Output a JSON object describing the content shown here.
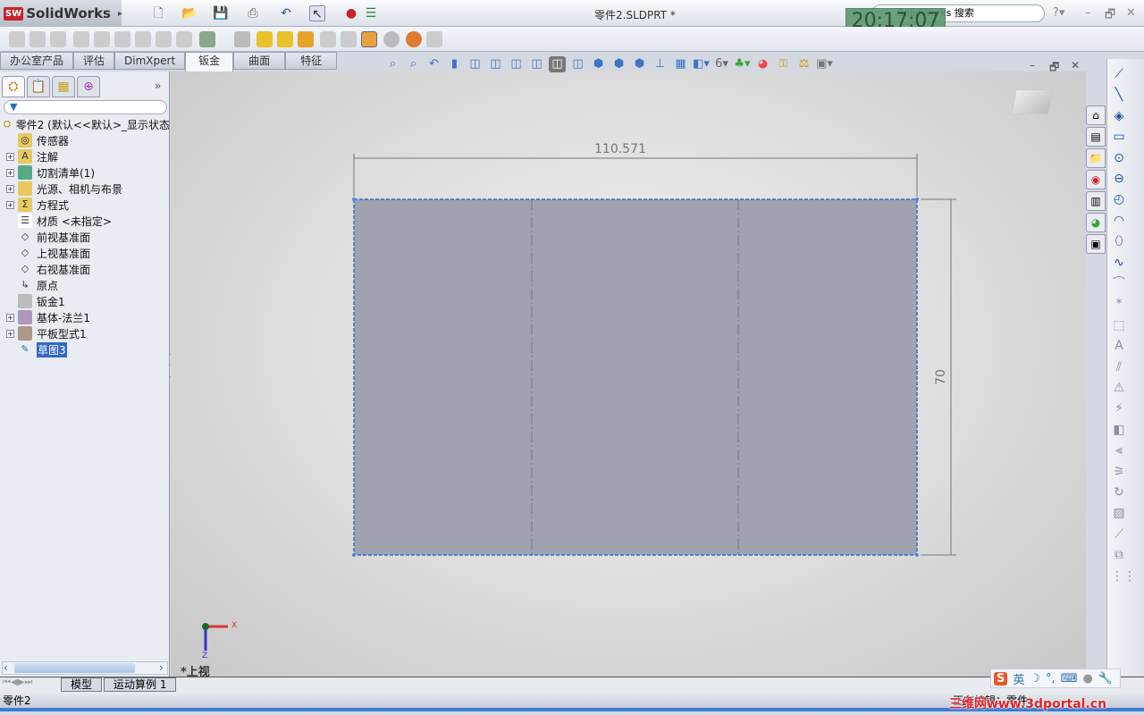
{
  "app": {
    "name": "SolidWorks",
    "document_title": "零件2.SLDPRT *",
    "clock": "20:17:07",
    "search_placeholder": "SolidWorks 搜索"
  },
  "command_tabs": [
    {
      "label": "办公室产品"
    },
    {
      "label": "评估"
    },
    {
      "label": "DimXpert"
    },
    {
      "label": "钣金",
      "active": true
    },
    {
      "label": "曲面"
    },
    {
      "label": "特征"
    }
  ],
  "feature_tree": {
    "root": "零件2  (默认<<默认>_显示状态",
    "items": [
      {
        "label": "传感器",
        "expandable": false,
        "icon": "sensor-folder-icon"
      },
      {
        "label": "注解",
        "expandable": true,
        "icon": "annotations-folder-icon"
      },
      {
        "label": "切割清单(1)",
        "expandable": true,
        "icon": "cut-list-icon"
      },
      {
        "label": "光源、相机与布景",
        "expandable": true,
        "icon": "lights-folder-icon"
      },
      {
        "label": "方程式",
        "expandable": true,
        "icon": "equations-folder-icon"
      },
      {
        "label": "材质 <未指定>",
        "expandable": false,
        "icon": "material-icon"
      },
      {
        "label": "前视基准面",
        "expandable": false,
        "icon": "plane-icon"
      },
      {
        "label": "上视基准面",
        "expandable": false,
        "icon": "plane-icon"
      },
      {
        "label": "右视基准面",
        "expandable": false,
        "icon": "plane-icon"
      },
      {
        "label": "原点",
        "expandable": false,
        "icon": "origin-icon"
      },
      {
        "label": "钣金1",
        "expandable": false,
        "icon": "sheet-metal-icon"
      },
      {
        "label": "基体-法兰1",
        "expandable": true,
        "icon": "base-flange-icon"
      },
      {
        "label": "平板型式1",
        "expandable": true,
        "icon": "flat-pattern-icon"
      },
      {
        "label": "草图3",
        "expandable": false,
        "icon": "sketch-icon",
        "selected": true
      }
    ]
  },
  "viewport": {
    "dimension_width": "110.571",
    "dimension_height": "70",
    "view_label": "*上视",
    "axis_x": "X",
    "axis_z": "Z",
    "sketch_fill": "#a0a2b2",
    "sketch_edge": "#2f6fd0"
  },
  "bottom_tabs": [
    {
      "label": "模型"
    },
    {
      "label": "运动算例 1"
    }
  ],
  "status": {
    "left": "零件2",
    "right": "正在编辑：零件"
  },
  "ime": {
    "lang": "英"
  },
  "watermark": "三维网www.3dportal.cn"
}
